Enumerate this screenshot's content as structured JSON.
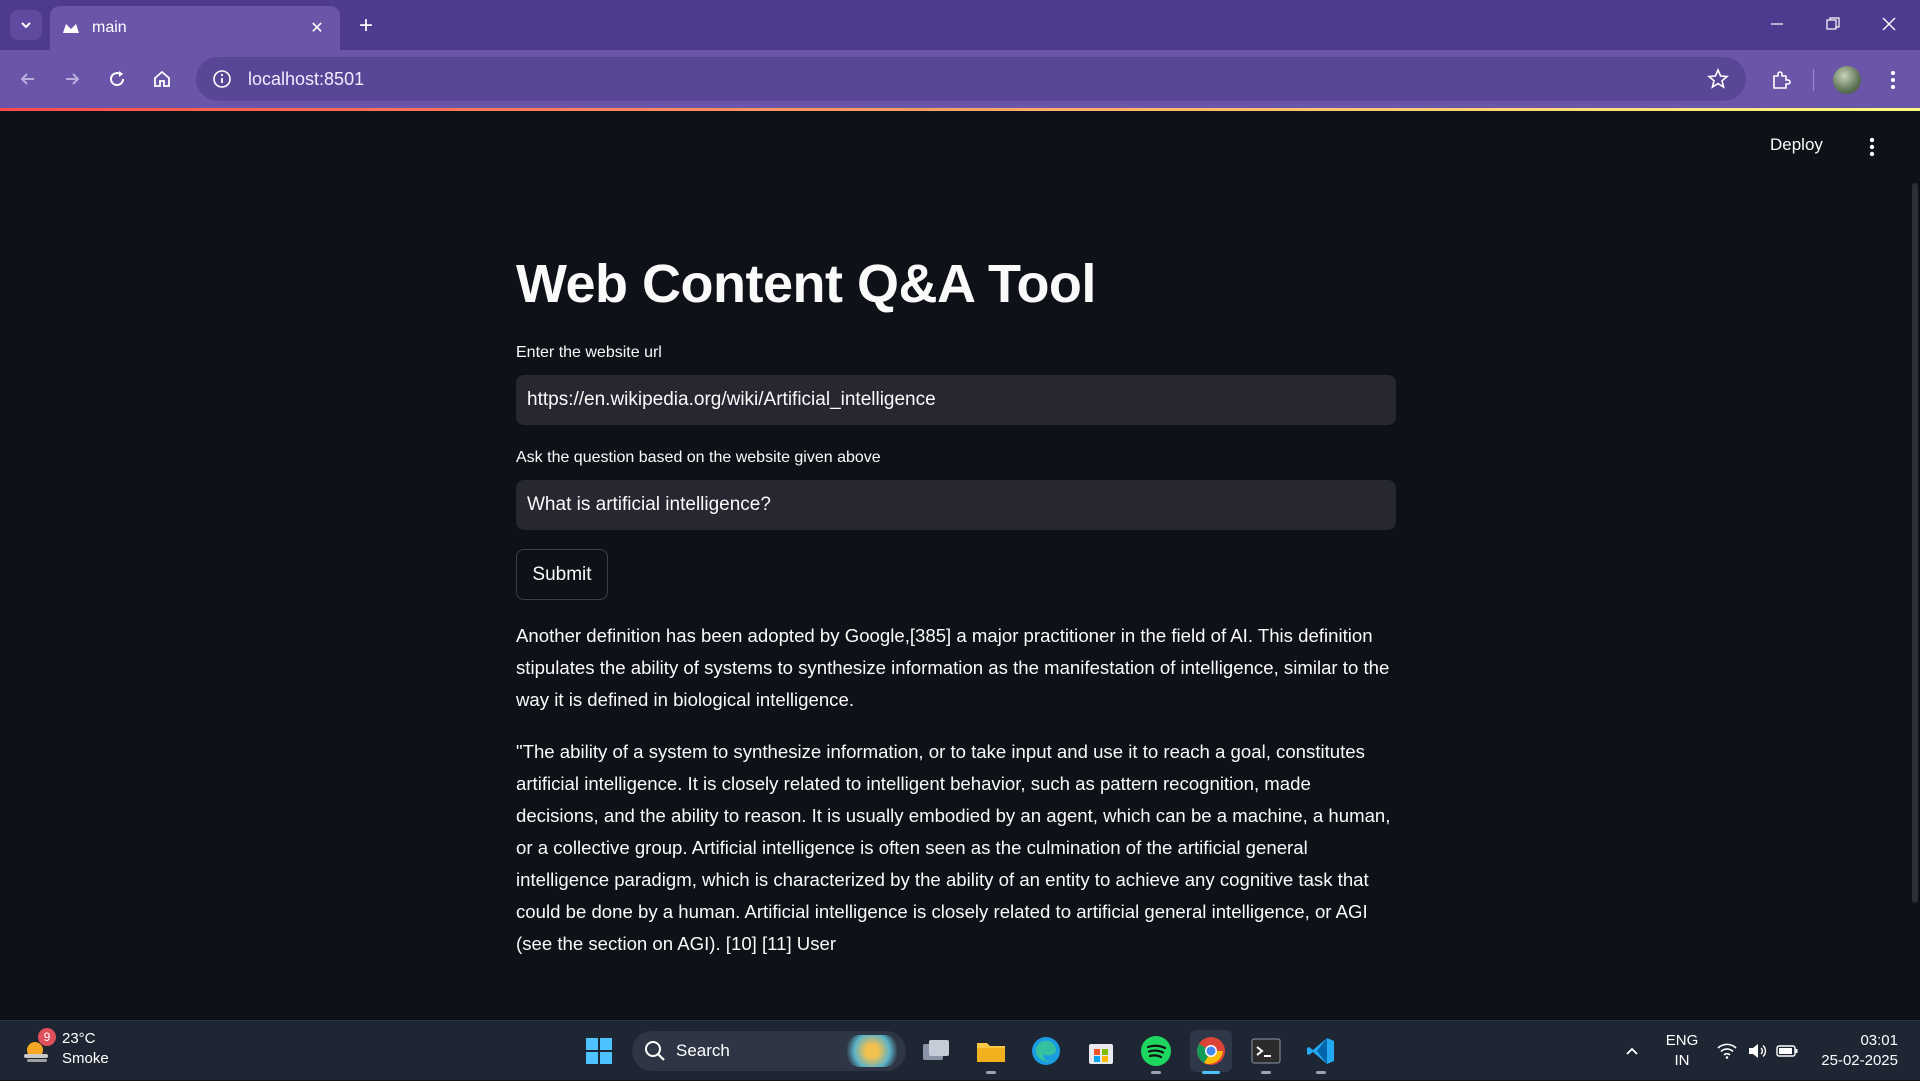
{
  "browser": {
    "tab_title": "main",
    "url": "localhost:8501"
  },
  "app": {
    "deploy_label": "Deploy",
    "title": "Web Content Q&A Tool",
    "url_field": {
      "label": "Enter the website url",
      "value": "https://en.wikipedia.org/wiki/Artificial_intelligence"
    },
    "question_field": {
      "label": "Ask the question based on the website given above",
      "value": "What is artificial intelligence?"
    },
    "submit_label": "Submit",
    "answer_paragraphs": [
      "Another definition has been adopted by Google,[385] a major practitioner in the field of AI. This definition stipulates the ability of systems to synthesize information as the manifestation of intelligence, similar to the way it is defined in biological intelligence.",
      "\"The ability of a system to synthesize information, or to take input and use it to reach a goal, constitutes artificial intelligence. It is closely related to intelligent behavior, such as pattern recognition, made decisions, and the ability to reason. It is usually embodied by an agent, which can be a machine, a human, or a collective group. Artificial intelligence is often seen as the culmination of the artificial general intelligence paradigm, which is characterized by the ability of an entity to achieve any cognitive task that could be done by a human. Artificial intelligence is closely related to artificial general intelligence, or AGI (see the section on AGI). [10] [11] User"
    ]
  },
  "taskbar": {
    "weather": {
      "temp": "23°C",
      "condition": "Smoke",
      "badge": "9"
    },
    "search_placeholder": "Search",
    "language": {
      "line1": "ENG",
      "line2": "IN"
    },
    "clock": {
      "time": "03:01",
      "date": "25-02-2025"
    }
  },
  "colors": {
    "background": "#0e1117",
    "input_bg": "#262730",
    "text": "#fafafa",
    "browser_frame": "#4e3a8e",
    "browser_toolbar": "#6a55a9"
  }
}
